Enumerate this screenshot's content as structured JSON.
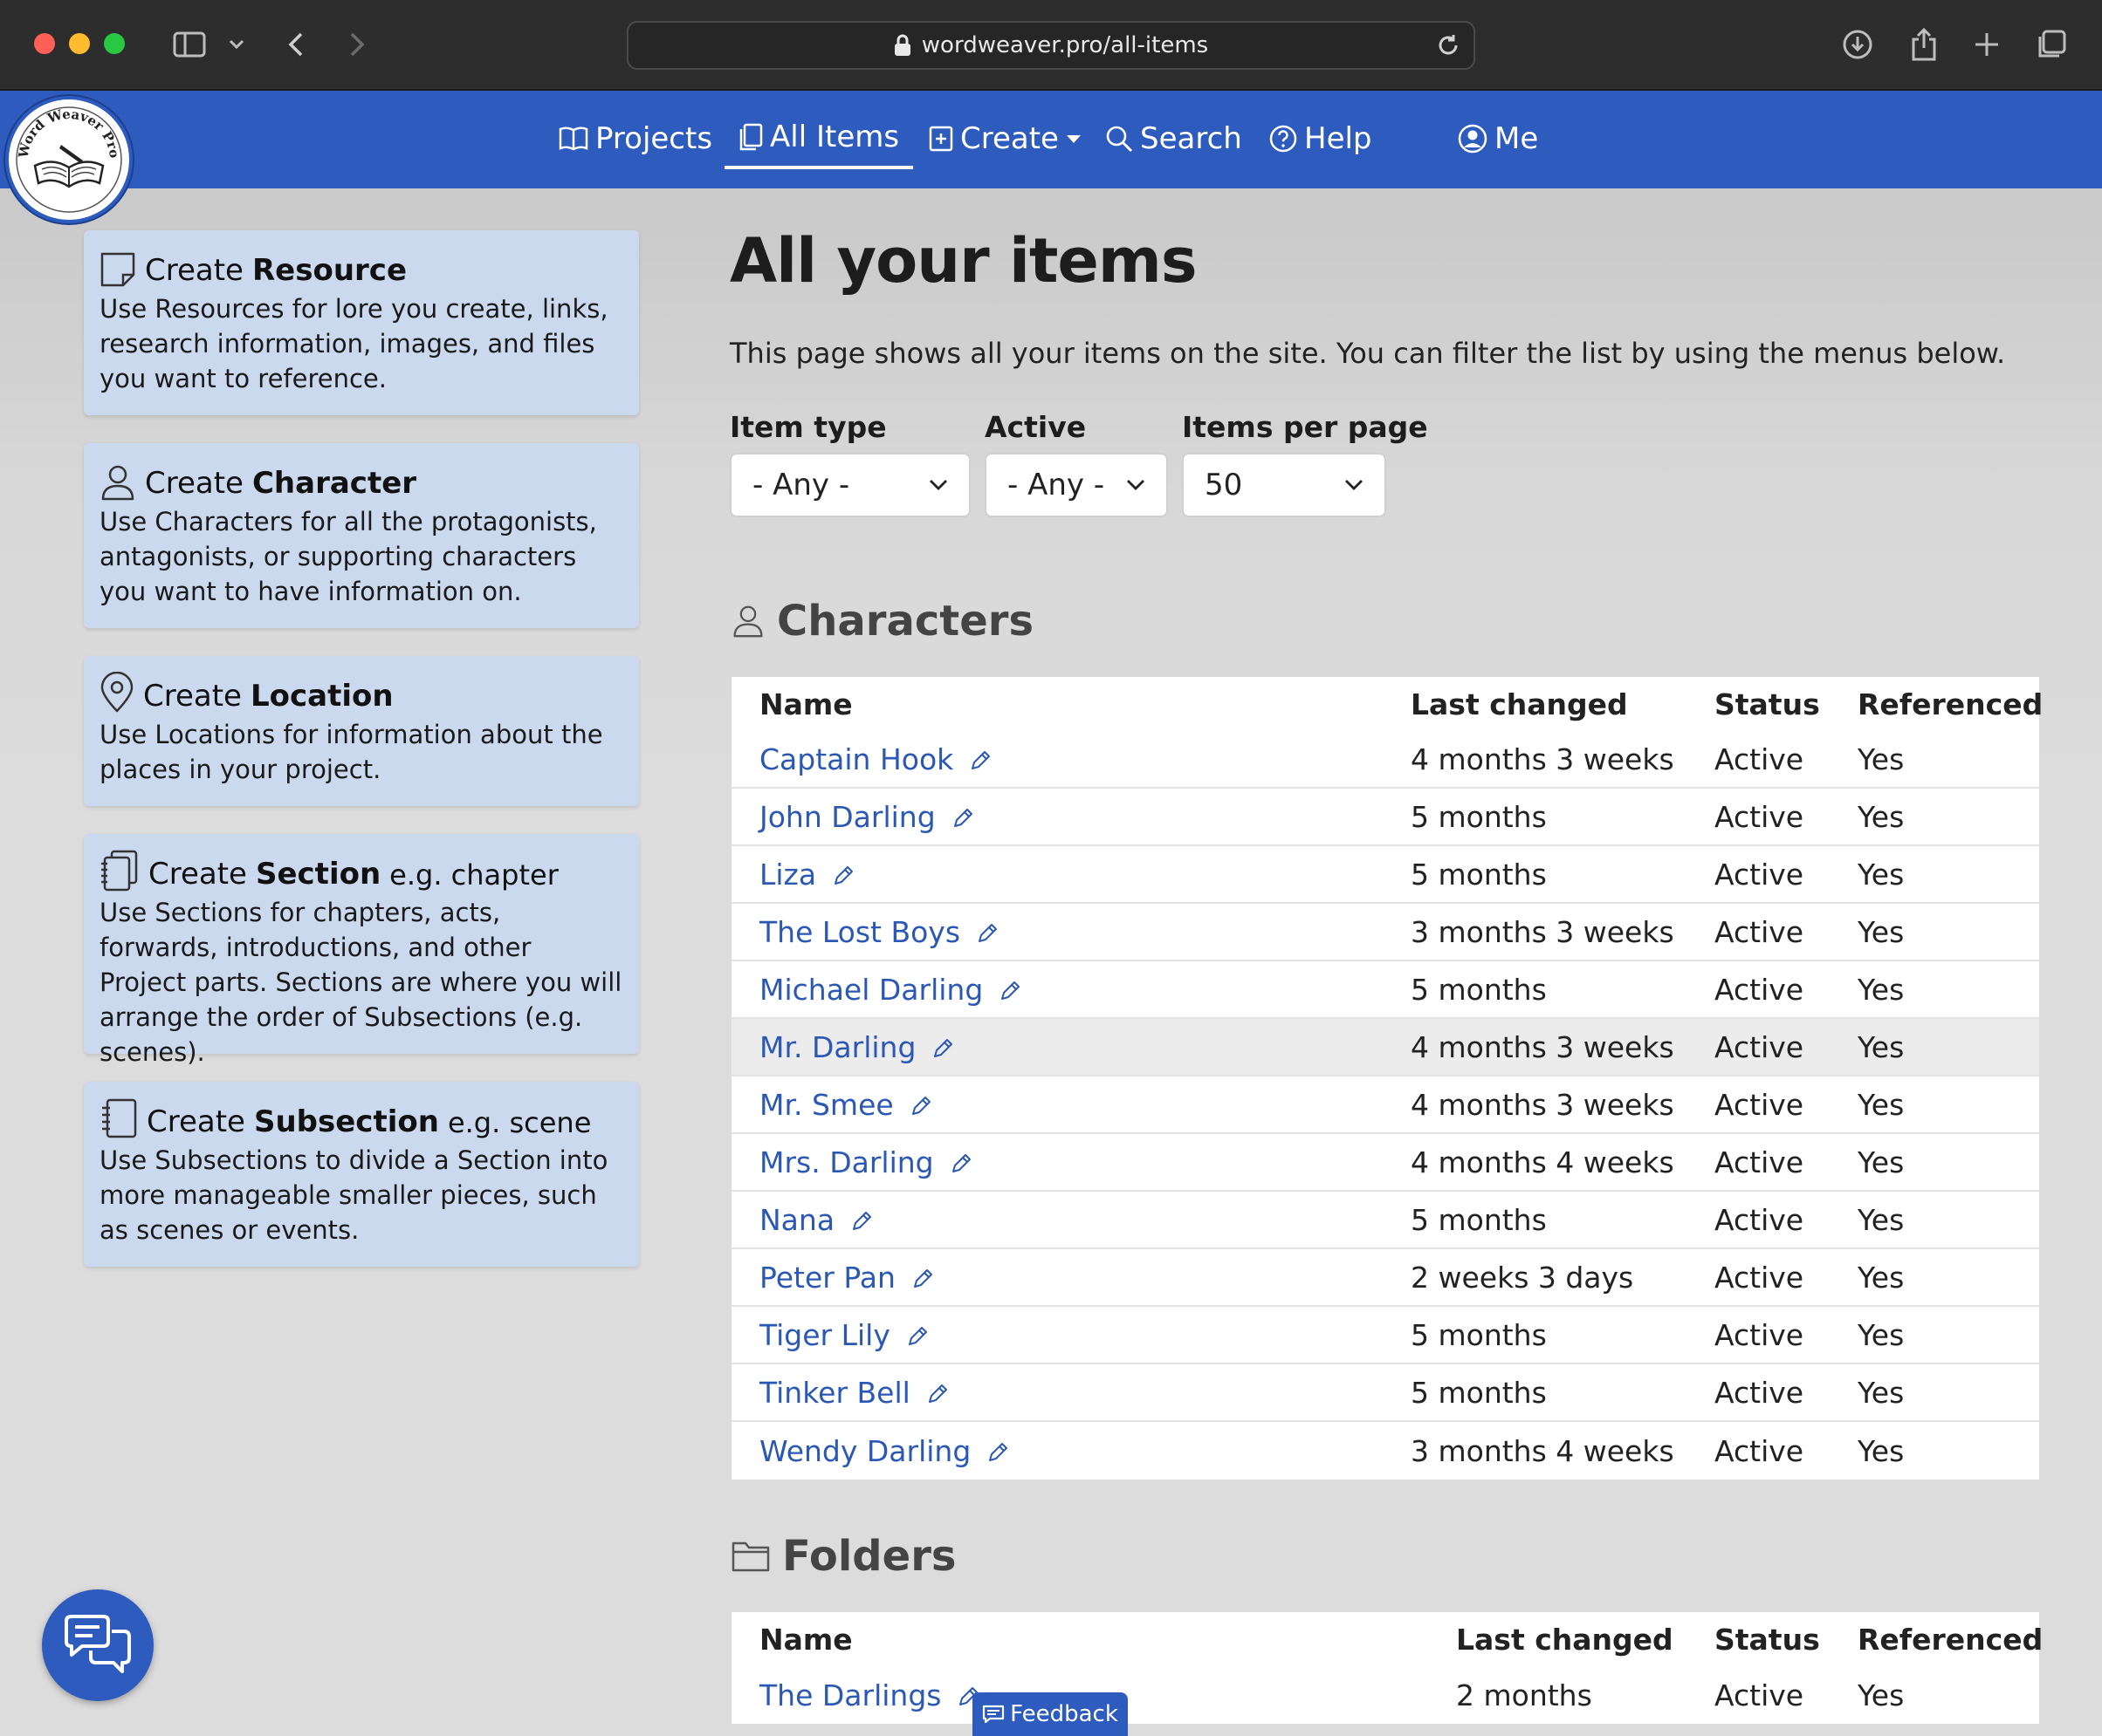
{
  "browser": {
    "url": "wordweaver.pro/all-items"
  },
  "nav": {
    "items": [
      {
        "label": "Projects",
        "icon": "book-open-icon"
      },
      {
        "label": "All Items",
        "icon": "copy-icon"
      },
      {
        "label": "Create",
        "icon": "plus-square-icon"
      },
      {
        "label": "Search",
        "icon": "search-icon"
      },
      {
        "label": "Help",
        "icon": "help-circle-icon"
      },
      {
        "label": "Me",
        "icon": "user-circle-icon"
      }
    ],
    "active": "All Items",
    "accent": "#2e5bbe"
  },
  "logo": {
    "text": "Word Weaver Pro"
  },
  "sidebar": {
    "cards": [
      {
        "prefix": "Create",
        "bold": "Resource",
        "eg": "",
        "desc": "Use Resources for lore you create, links, research information, images, and files you want to reference."
      },
      {
        "prefix": "Create",
        "bold": "Character",
        "eg": "",
        "desc": "Use Characters for all the protagonists, antagonists, or supporting characters you want to have information on."
      },
      {
        "prefix": "Create",
        "bold": "Location",
        "eg": "",
        "desc": "Use Locations for information about the places in your project."
      },
      {
        "prefix": "Create",
        "bold": "Section",
        "eg": "e.g. chapter",
        "desc": "Use Sections for chapters, acts, forwards, introductions, and other Project parts. Sections are where you will arrange the order of Subsections (e.g. scenes)."
      },
      {
        "prefix": "Create",
        "bold": "Subsection",
        "eg": "e.g. scene",
        "desc": "Use Subsections to divide a Section into more manageable smaller pieces, such as scenes or events."
      }
    ]
  },
  "main": {
    "title": "All your items",
    "intro": "This page shows all your items on the site. You can filter the list by using the menus below.",
    "filters": [
      {
        "label": "Item type",
        "value": "- Any -"
      },
      {
        "label": "Active",
        "value": "- Any -"
      },
      {
        "label": "Items per page",
        "value": "50"
      }
    ]
  },
  "characters": {
    "heading": "Characters",
    "columns": [
      "Name",
      "Last changed",
      "Status",
      "Referenced"
    ],
    "rows": [
      {
        "name": "Captain Hook",
        "changed": "4 months 3 weeks",
        "status": "Active",
        "ref": "Yes"
      },
      {
        "name": "John Darling",
        "changed": "5 months",
        "status": "Active",
        "ref": "Yes"
      },
      {
        "name": "Liza",
        "changed": "5 months",
        "status": "Active",
        "ref": "Yes"
      },
      {
        "name": "The Lost Boys",
        "changed": "3 months 3 weeks",
        "status": "Active",
        "ref": "Yes"
      },
      {
        "name": "Michael Darling",
        "changed": "5 months",
        "status": "Active",
        "ref": "Yes"
      },
      {
        "name": "Mr. Darling",
        "changed": "4 months 3 weeks",
        "status": "Active",
        "ref": "Yes"
      },
      {
        "name": "Mr. Smee",
        "changed": "4 months 3 weeks",
        "status": "Active",
        "ref": "Yes"
      },
      {
        "name": "Mrs. Darling",
        "changed": "4 months 4 weeks",
        "status": "Active",
        "ref": "Yes"
      },
      {
        "name": "Nana",
        "changed": "5 months",
        "status": "Active",
        "ref": "Yes"
      },
      {
        "name": "Peter Pan",
        "changed": "2 weeks 3 days",
        "status": "Active",
        "ref": "Yes"
      },
      {
        "name": "Tiger Lily",
        "changed": "5 months",
        "status": "Active",
        "ref": "Yes"
      },
      {
        "name": "Tinker Bell",
        "changed": "5 months",
        "status": "Active",
        "ref": "Yes"
      },
      {
        "name": "Wendy Darling",
        "changed": "3 months 4 weeks",
        "status": "Active",
        "ref": "Yes"
      }
    ]
  },
  "folders": {
    "heading": "Folders",
    "columns": [
      "Name",
      "Last changed",
      "Status",
      "Referenced"
    ],
    "rows": [
      {
        "name": "The Darlings",
        "changed": "2 months",
        "status": "Active",
        "ref": "Yes"
      }
    ]
  },
  "feedback": {
    "label": "Feedback"
  }
}
